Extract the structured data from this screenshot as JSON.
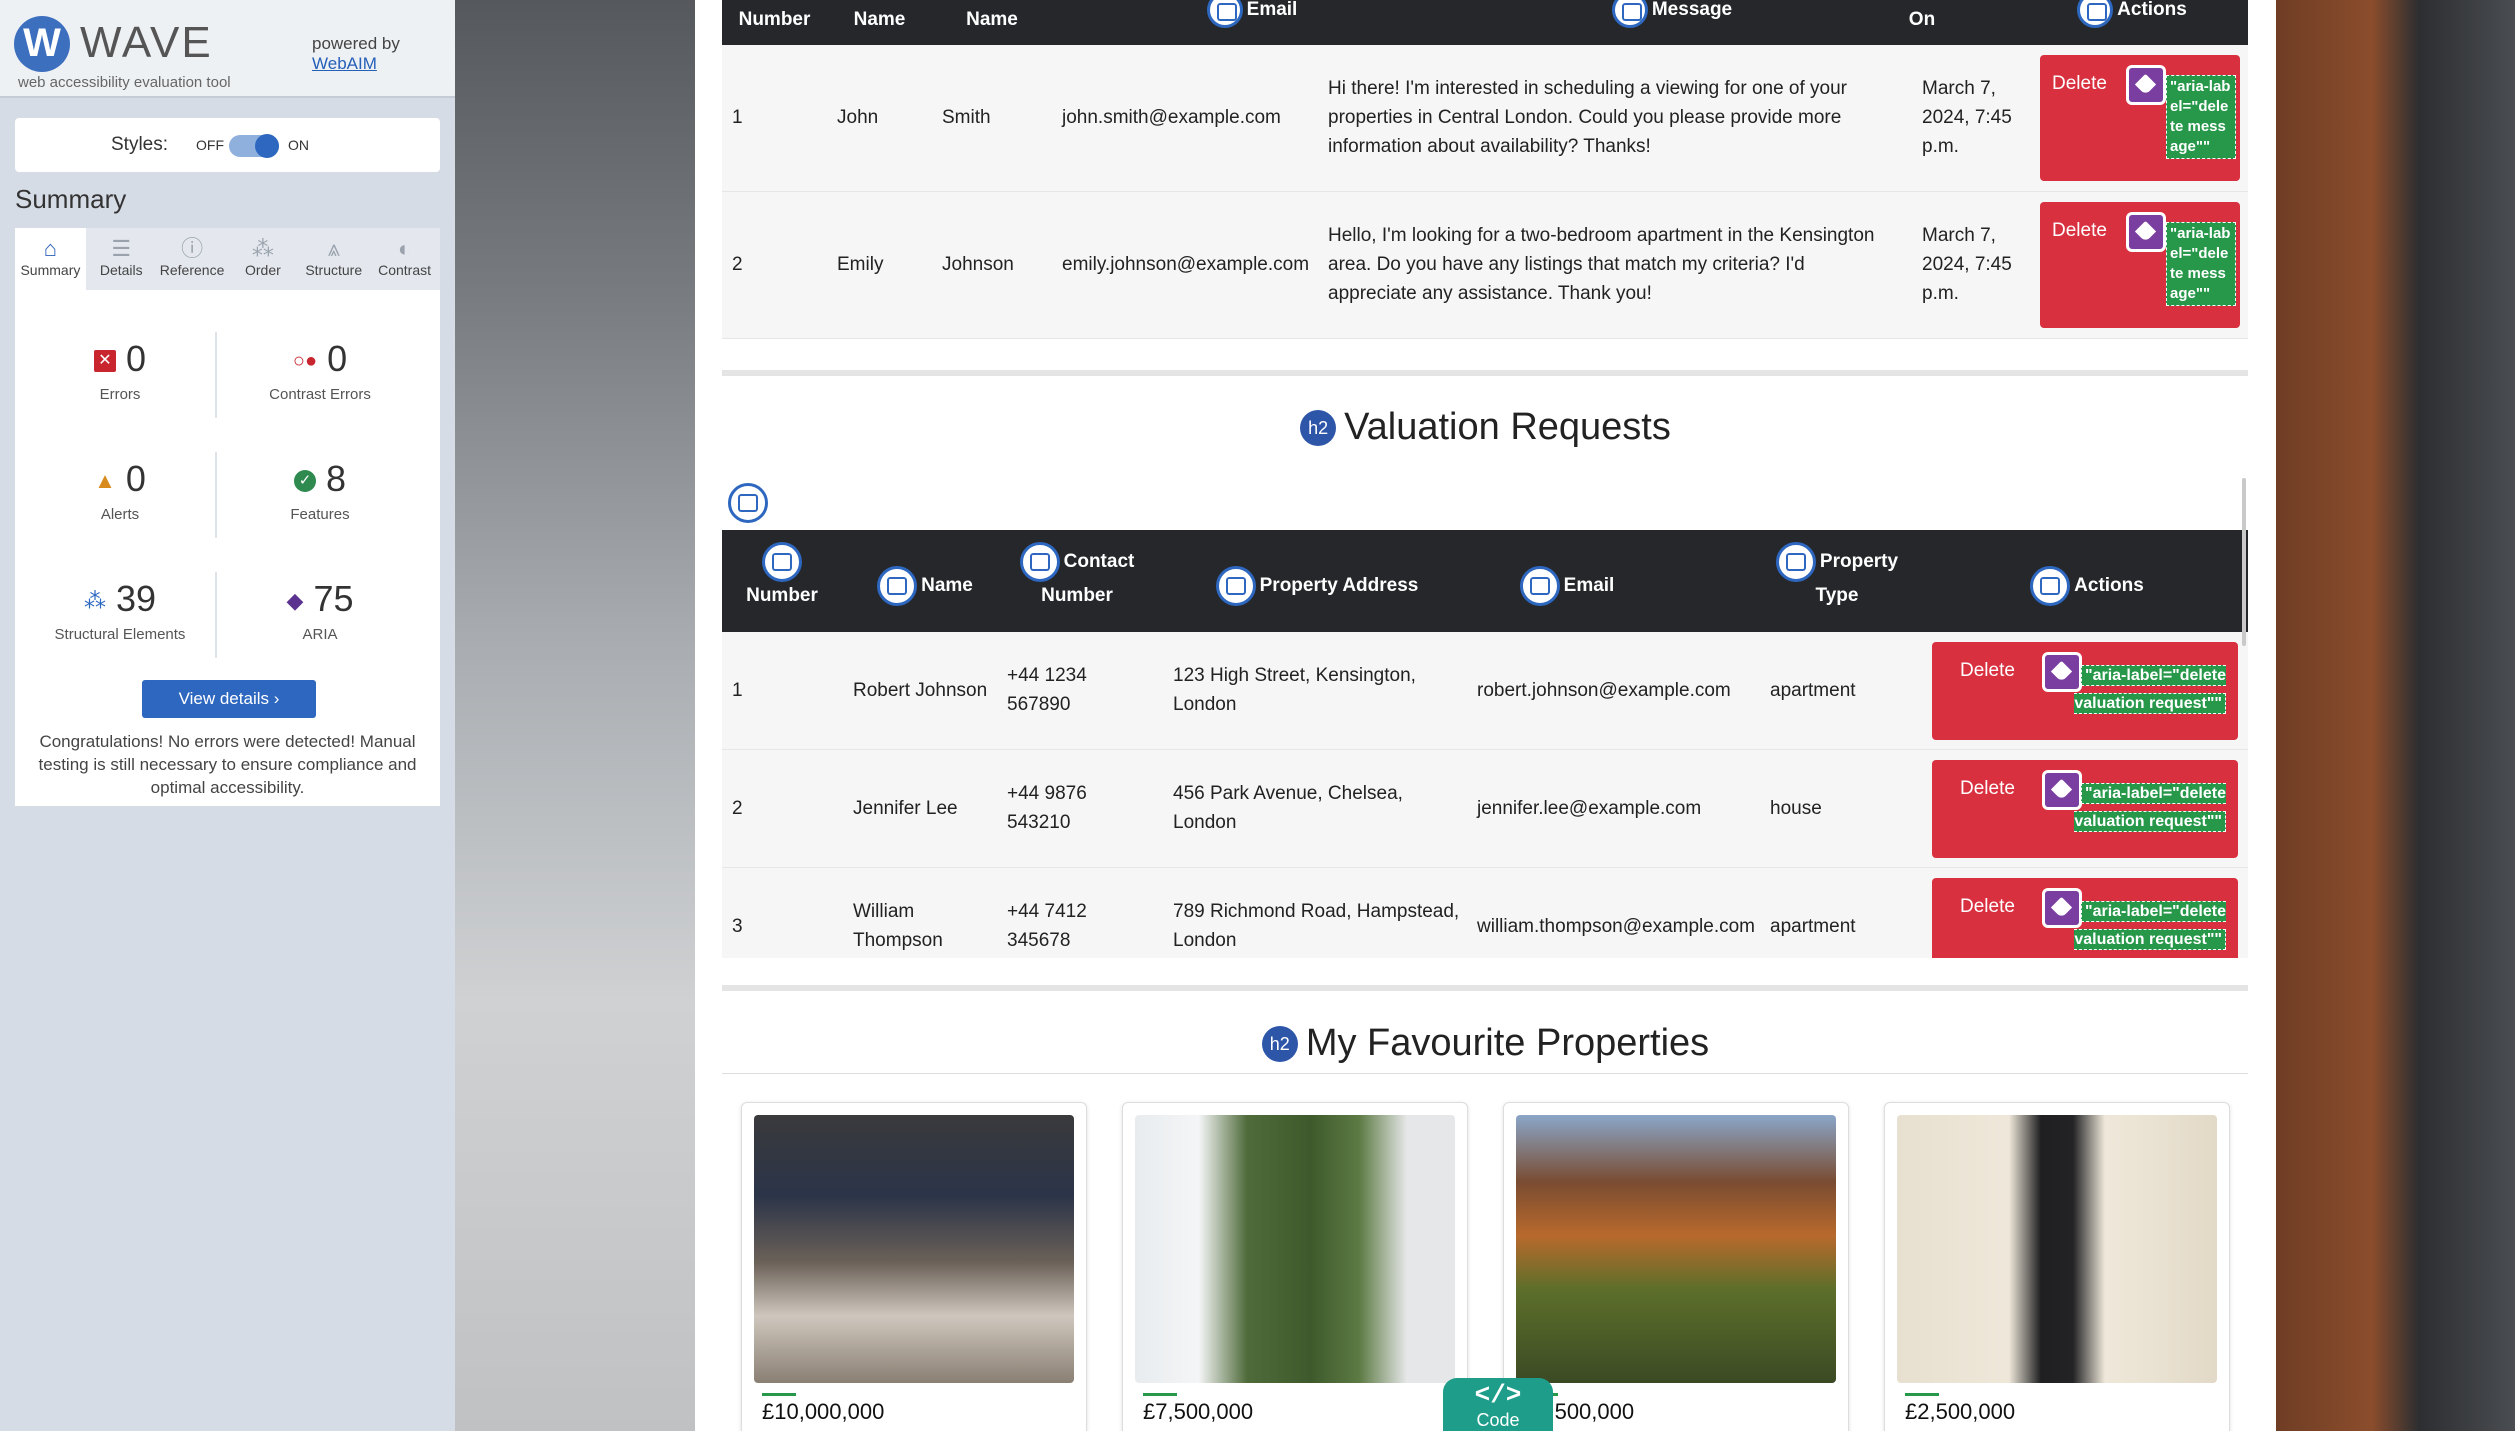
{
  "wave": {
    "logo_letter": "W",
    "name": "WAVE",
    "tagline": "web accessibility evaluation tool",
    "powered_by": "powered by",
    "webaim_link": "WebAIM",
    "styles_label": "Styles:",
    "styles_off": "OFF",
    "styles_on": "ON",
    "summary_title": "Summary",
    "tabs": [
      {
        "label": "Summary",
        "icon": "home-icon",
        "glyph": "⌂"
      },
      {
        "label": "Details",
        "icon": "list-icon",
        "glyph": "☰"
      },
      {
        "label": "Reference",
        "icon": "info-icon",
        "glyph": "ⓘ"
      },
      {
        "label": "Order",
        "icon": "order-icon",
        "glyph": "⁂"
      },
      {
        "label": "Structure",
        "icon": "structure-icon",
        "glyph": "⩓"
      },
      {
        "label": "Contrast",
        "icon": "contrast-icon",
        "glyph": "◐"
      }
    ],
    "stats": {
      "errors": {
        "value": "0",
        "label": "Errors"
      },
      "contrast": {
        "value": "0",
        "label": "Contrast Errors"
      },
      "alerts": {
        "value": "0",
        "label": "Alerts"
      },
      "features": {
        "value": "8",
        "label": "Features"
      },
      "structural": {
        "value": "39",
        "label": "Structural Elements"
      },
      "aria": {
        "value": "75",
        "label": "ARIA"
      }
    },
    "view_details": "View details ›",
    "congrats": "Congratulations! No errors were detected! Manual testing is still necessary to ensure compliance and optimal accessibility."
  },
  "messages_table": {
    "headers": [
      "Number",
      "Name",
      "Name",
      "Email",
      "Message",
      "On",
      "Actions"
    ],
    "rows": [
      {
        "number": "1",
        "first": "John",
        "last": "Smith",
        "email": "john.smith@example.com",
        "message": "Hi there! I'm interested in scheduling a viewing for one of your properties in Central London. Could you please provide more information about availability? Thanks!",
        "date": "March 7, 2024, 7:45 p.m.",
        "delete": "Delete",
        "aria": "\"aria-label=\"delete message\"\""
      },
      {
        "number": "2",
        "first": "Emily",
        "last": "Johnson",
        "email": "emily.johnson@example.com",
        "message": "Hello, I'm looking for a two-bedroom apartment in the Kensington area. Do you have any listings that match my criteria? I'd appreciate any assistance. Thank you!",
        "date": "March 7, 2024, 7:45 p.m.",
        "delete": "Delete",
        "aria": "\"aria-label=\"delete message\"\""
      }
    ]
  },
  "valuation": {
    "h2_badge": "h2",
    "title": "Valuation Requests",
    "headers": [
      "Number",
      "Name",
      "Contact Number",
      "Property Address",
      "Email",
      "Property Type",
      "Actions"
    ],
    "rows": [
      {
        "number": "1",
        "name": "Robert Johnson",
        "contact": "+44 1234 567890",
        "address": "123 High Street, Kensington, London",
        "email": "robert.johnson@example.com",
        "type": "apartment",
        "delete": "Delete",
        "aria": "\"aria-label=\"delete valuation request\"\""
      },
      {
        "number": "2",
        "name": "Jennifer Lee",
        "contact": "+44 9876 543210",
        "address": "456 Park Avenue, Chelsea, London",
        "email": "jennifer.lee@example.com",
        "type": "house",
        "delete": "Delete",
        "aria": "\"aria-label=\"delete valuation request\"\""
      },
      {
        "number": "3",
        "name": "William Thompson",
        "contact": "+44 7412 345678",
        "address": "789 Richmond Road, Hampstead, London",
        "email": "william.thompson@example.com",
        "type": "apartment",
        "delete": "Delete",
        "aria": "\"aria-label=\"delete valuation request\"\""
      }
    ]
  },
  "favourites": {
    "h2_badge": "h2",
    "title": "My Favourite Properties",
    "cards": [
      {
        "price": "£10,000,000"
      },
      {
        "price": "£7,500,000"
      },
      {
        "price": "£5,500,000"
      },
      {
        "price": "£2,500,000"
      }
    ]
  },
  "code_tab": {
    "icon": "</>",
    "label": "Code"
  },
  "colors": {
    "accent": "#2d67bf",
    "delete": "#d93040",
    "aria_green": "#27984a",
    "aria_purple": "#7a3ea0",
    "header_dark": "#25272b"
  }
}
